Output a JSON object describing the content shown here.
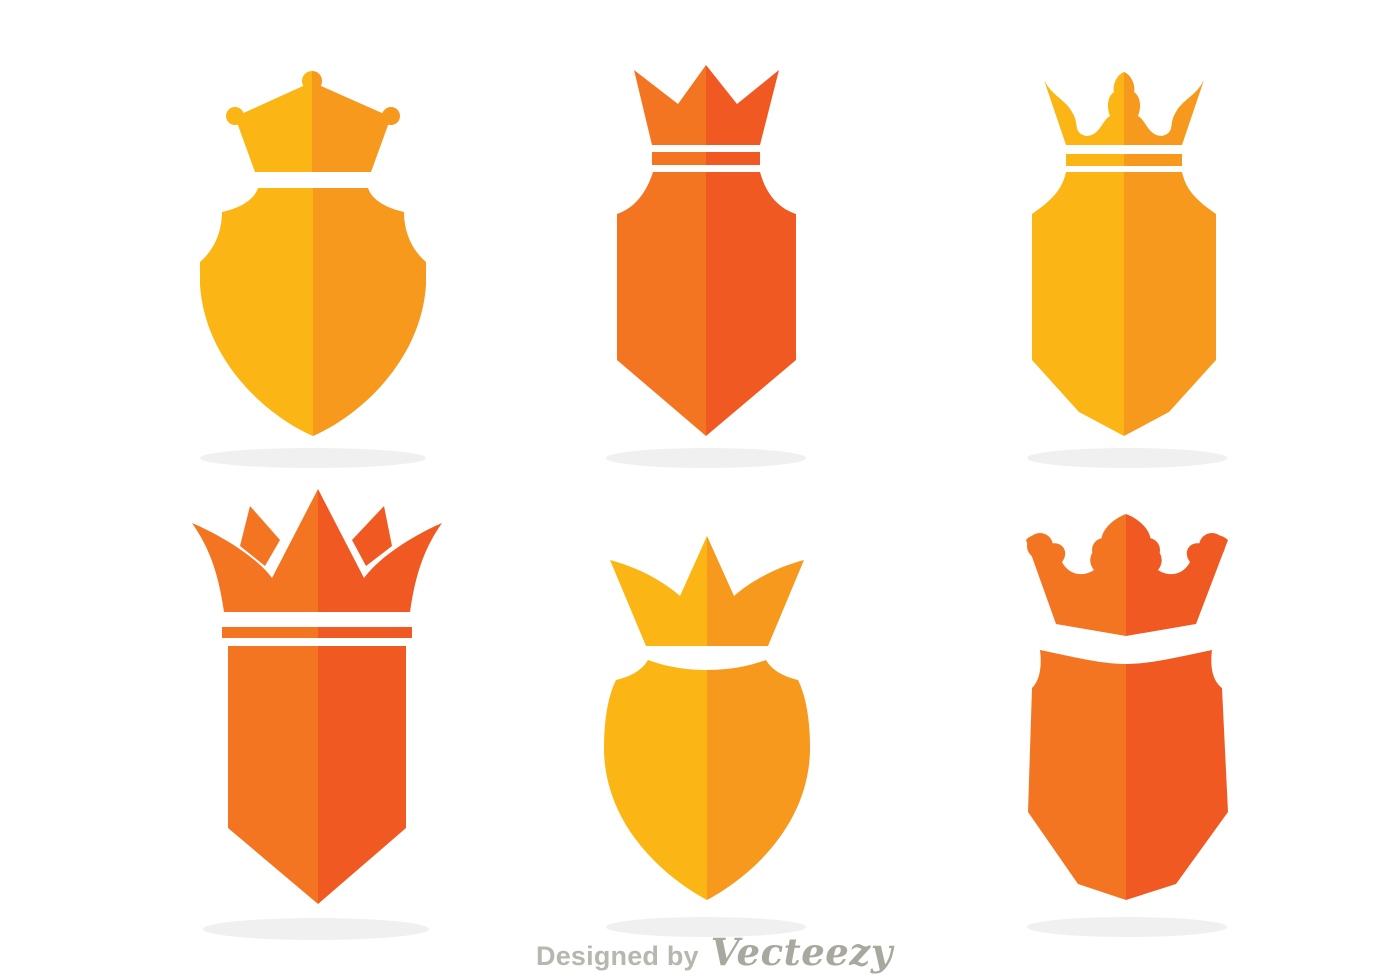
{
  "colors": {
    "gold_light": "#fbb515",
    "gold_dark": "#f6991d",
    "orange_light": "#f37522",
    "orange_dark": "#f05a22",
    "shadow": "#f0f0f0",
    "watermark_prefix": "#b7b7b0",
    "watermark_brand": "#a8a89e"
  },
  "emblems": [
    {
      "name": "gold-pointed-crown-rounded-shield",
      "palette": "gold",
      "crown": "pointed-ball-tips",
      "shield": "rounded"
    },
    {
      "name": "orange-spiked-crown-pointed-shield",
      "palette": "orange",
      "crown": "spiked",
      "shield": "pointed"
    },
    {
      "name": "gold-fleur-crown-octagon-shield",
      "palette": "gold",
      "crown": "fleur",
      "shield": "octagon"
    },
    {
      "name": "orange-large-crown-banner-shield",
      "palette": "orange",
      "crown": "large-spiked",
      "shield": "banner"
    },
    {
      "name": "gold-curved-crown-rounded-shield",
      "palette": "gold",
      "crown": "curved",
      "shield": "rounded"
    },
    {
      "name": "orange-fleur-crown-octagon-shield",
      "palette": "orange",
      "crown": "fleur",
      "shield": "octagon"
    }
  ],
  "watermark": {
    "prefix": "Designed by",
    "brand": "Vecteezy"
  }
}
